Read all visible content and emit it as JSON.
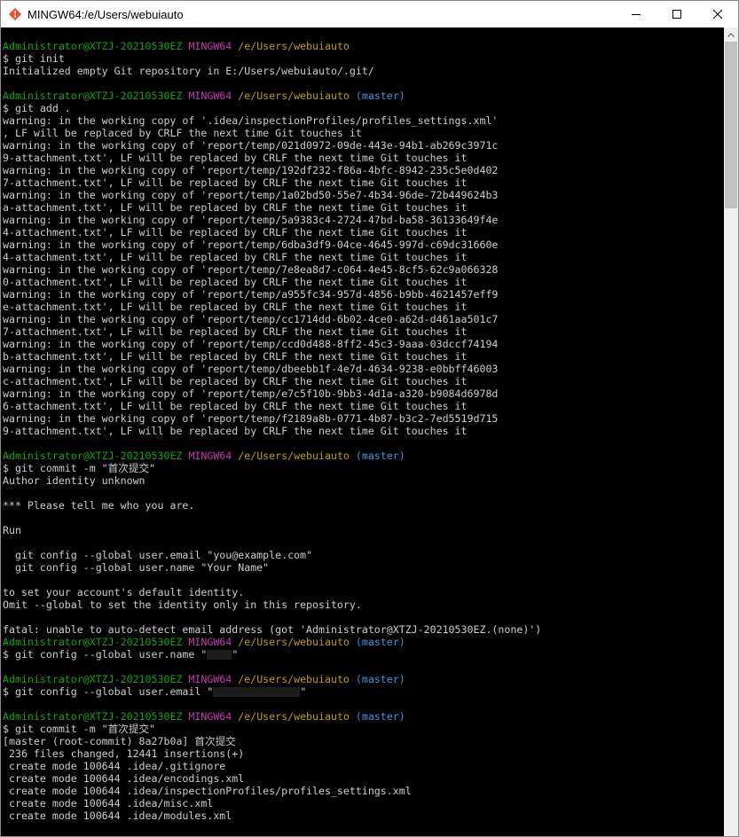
{
  "window": {
    "title": "MINGW64:/e/Users/webuiauto",
    "app_icon": "git-mingw-icon",
    "buttons": [
      "minimize-icon",
      "maximize-icon",
      "close-icon"
    ]
  },
  "terminal": {
    "background": "#000000",
    "colors": {
      "text": "#cccccc",
      "user": "#13a10e",
      "msystem": "#c239b3",
      "path": "#c19c00",
      "branch": "#3a96dd"
    },
    "lines": [
      {
        "t": "prompt",
        "user": "Administrator@XTZJ-20210530EZ",
        "msys": "MINGW64",
        "path": "/e/Users/webuiauto",
        "branch": ""
      },
      {
        "t": "text",
        "text": "$ git init"
      },
      {
        "t": "text",
        "text": "Initialized empty Git repository in E:/Users/webuiauto/.git/"
      },
      {
        "t": "blank",
        "text": ""
      },
      {
        "t": "prompt",
        "user": "Administrator@XTZJ-20210530EZ",
        "msys": "MINGW64",
        "path": "/e/Users/webuiauto",
        "branch": "(master)"
      },
      {
        "t": "text",
        "text": "$ git add ."
      },
      {
        "t": "text",
        "text": "warning: in the working copy of '.idea/inspectionProfiles/profiles_settings.xml'"
      },
      {
        "t": "text",
        "text": ", LF will be replaced by CRLF the next time Git touches it"
      },
      {
        "t": "text",
        "text": "warning: in the working copy of 'report/temp/021d0972-09de-443e-94b1-ab269c3971c"
      },
      {
        "t": "text",
        "text": "9-attachment.txt', LF will be replaced by CRLF the next time Git touches it"
      },
      {
        "t": "text",
        "text": "warning: in the working copy of 'report/temp/192df232-f86a-4bfc-8942-235c5e0d402"
      },
      {
        "t": "text",
        "text": "7-attachment.txt', LF will be replaced by CRLF the next time Git touches it"
      },
      {
        "t": "text",
        "text": "warning: in the working copy of 'report/temp/1a02bd50-55e7-4b34-96de-72b449624b3"
      },
      {
        "t": "text",
        "text": "a-attachment.txt', LF will be replaced by CRLF the next time Git touches it"
      },
      {
        "t": "text",
        "text": "warning: in the working copy of 'report/temp/5a9383c4-2724-47bd-ba58-36133649f4e"
      },
      {
        "t": "text",
        "text": "4-attachment.txt', LF will be replaced by CRLF the next time Git touches it"
      },
      {
        "t": "text",
        "text": "warning: in the working copy of 'report/temp/6dba3df9-04ce-4645-997d-c69dc31660e"
      },
      {
        "t": "text",
        "text": "4-attachment.txt', LF will be replaced by CRLF the next time Git touches it"
      },
      {
        "t": "text",
        "text": "warning: in the working copy of 'report/temp/7e8ea8d7-c064-4e45-8cf5-62c9a066328"
      },
      {
        "t": "text",
        "text": "0-attachment.txt', LF will be replaced by CRLF the next time Git touches it"
      },
      {
        "t": "text",
        "text": "warning: in the working copy of 'report/temp/a955fc34-957d-4856-b9bb-4621457eff9"
      },
      {
        "t": "text",
        "text": "e-attachment.txt', LF will be replaced by CRLF the next time Git touches it"
      },
      {
        "t": "text",
        "text": "warning: in the working copy of 'report/temp/cc1714dd-6b02-4ce0-a62d-d461aa501c7"
      },
      {
        "t": "text",
        "text": "7-attachment.txt', LF will be replaced by CRLF the next time Git touches it"
      },
      {
        "t": "text",
        "text": "warning: in the working copy of 'report/temp/ccd0d488-8ff2-45c3-9aaa-03dccf74194"
      },
      {
        "t": "text",
        "text": "b-attachment.txt', LF will be replaced by CRLF the next time Git touches it"
      },
      {
        "t": "text",
        "text": "warning: in the working copy of 'report/temp/dbeebb1f-4e7d-4634-9238-e0bbff46003"
      },
      {
        "t": "text",
        "text": "c-attachment.txt', LF will be replaced by CRLF the next time Git touches it"
      },
      {
        "t": "text",
        "text": "warning: in the working copy of 'report/temp/e7c5f10b-9bb3-4d1a-a320-b9084d6978d"
      },
      {
        "t": "text",
        "text": "6-attachment.txt', LF will be replaced by CRLF the next time Git touches it"
      },
      {
        "t": "text",
        "text": "warning: in the working copy of 'report/temp/f2189a8b-0771-4b87-b3c2-7ed5519d715"
      },
      {
        "t": "text",
        "text": "9-attachment.txt', LF will be replaced by CRLF the next time Git touches it"
      },
      {
        "t": "blank",
        "text": ""
      },
      {
        "t": "prompt",
        "user": "Administrator@XTZJ-20210530EZ",
        "msys": "MINGW64",
        "path": "/e/Users/webuiauto",
        "branch": "(master)"
      },
      {
        "t": "text",
        "text": "$ git commit -m \"首次提交\""
      },
      {
        "t": "text",
        "text": "Author identity unknown"
      },
      {
        "t": "blank",
        "text": ""
      },
      {
        "t": "text",
        "text": "*** Please tell me who you are."
      },
      {
        "t": "blank",
        "text": ""
      },
      {
        "t": "text",
        "text": "Run"
      },
      {
        "t": "blank",
        "text": ""
      },
      {
        "t": "text",
        "text": "  git config --global user.email \"you@example.com\""
      },
      {
        "t": "text",
        "text": "  git config --global user.name \"Your Name\""
      },
      {
        "t": "blank",
        "text": ""
      },
      {
        "t": "text",
        "text": "to set your account's default identity."
      },
      {
        "t": "text",
        "text": "Omit --global to set the identity only in this repository."
      },
      {
        "t": "blank",
        "text": ""
      },
      {
        "t": "text",
        "text": "fatal: unable to auto-detect email address (got 'Administrator@XTZJ-20210530EZ.(none)')"
      },
      {
        "t": "prompt",
        "user": "Administrator@XTZJ-20210530EZ",
        "msys": "MINGW64",
        "path": "/e/Users/webuiauto",
        "branch": "(master)"
      },
      {
        "t": "redacted",
        "before": "$ git config --global user.name \"",
        "after": "\"",
        "redact_chars": 4
      },
      {
        "t": "blank",
        "text": ""
      },
      {
        "t": "prompt",
        "user": "Administrator@XTZJ-20210530EZ",
        "msys": "MINGW64",
        "path": "/e/Users/webuiauto",
        "branch": "(master)"
      },
      {
        "t": "redacted",
        "before": "$ git config --global user.email \"",
        "after": "\"",
        "redact_chars": 14
      },
      {
        "t": "blank",
        "text": ""
      },
      {
        "t": "prompt",
        "user": "Administrator@XTZJ-20210530EZ",
        "msys": "MINGW64",
        "path": "/e/Users/webuiauto",
        "branch": "(master)"
      },
      {
        "t": "text",
        "text": "$ git commit -m \"首次提交\""
      },
      {
        "t": "text",
        "text": "[master (root-commit) 8a27b0a] 首次提交"
      },
      {
        "t": "text",
        "text": " 236 files changed, 12441 insertions(+)"
      },
      {
        "t": "text",
        "text": " create mode 100644 .idea/.gitignore"
      },
      {
        "t": "text",
        "text": " create mode 100644 .idea/encodings.xml"
      },
      {
        "t": "text",
        "text": " create mode 100644 .idea/inspectionProfiles/profiles_settings.xml"
      },
      {
        "t": "text",
        "text": " create mode 100644 .idea/misc.xml"
      },
      {
        "t": "text",
        "text": " create mode 100644 .idea/modules.xml"
      }
    ]
  }
}
